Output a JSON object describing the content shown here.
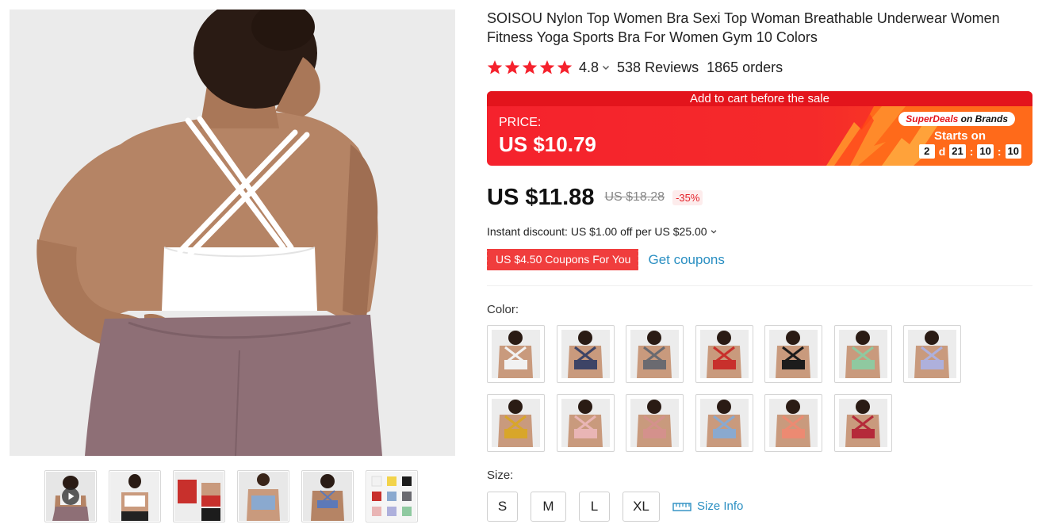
{
  "product": {
    "title": "SOISOU Nylon Top Women Bra Sexi Top Woman Breathable Underwear Women Fitness Yoga Sports Bra For Women Gym 10 Colors",
    "rating": "4.8",
    "reviews": "538 Reviews",
    "orders": "1865 orders"
  },
  "sale_banner": {
    "top_text": "Add to cart before the sale",
    "price_label": "PRICE:",
    "price_value": "US $10.79",
    "brand_super": "SuperDeals",
    "brand_rest": " on Brands",
    "starts_on": "Starts on",
    "countdown": {
      "days": "2",
      "d_label": "d",
      "hours": "21",
      "minutes": "10",
      "seconds": "10"
    }
  },
  "price": {
    "current": "US $11.88",
    "original": "US $18.28",
    "discount": "-35%"
  },
  "instant_discount": "Instant discount: US $1.00 off per US $25.00",
  "coupon": {
    "badge": "US $4.50 Coupons For You",
    "link": "Get coupons"
  },
  "color_label": "Color:",
  "colors": [
    {
      "name": "white",
      "hex": "#f2f2f2"
    },
    {
      "name": "navy",
      "hex": "#3d4466"
    },
    {
      "name": "grey",
      "hex": "#6a6a70"
    },
    {
      "name": "red",
      "hex": "#c8302c"
    },
    {
      "name": "black",
      "hex": "#1c1c1c"
    },
    {
      "name": "mint",
      "hex": "#8fc9a0"
    },
    {
      "name": "lavender",
      "hex": "#aeb0dc"
    },
    {
      "name": "mustard",
      "hex": "#d8a62a"
    },
    {
      "name": "pink",
      "hex": "#e9b5b5"
    },
    {
      "name": "dusty-rose",
      "hex": "#d4918c"
    },
    {
      "name": "light-blue",
      "hex": "#8aa9cf"
    },
    {
      "name": "coral",
      "hex": "#ec8a72"
    },
    {
      "name": "crimson",
      "hex": "#b52a3a"
    }
  ],
  "size_label": "Size:",
  "sizes": [
    "S",
    "M",
    "L",
    "XL"
  ],
  "size_info": "Size Info",
  "thumbnails": [
    {
      "icon": "play-icon",
      "color": "#f2f2f2"
    },
    {
      "color": "#f2f2f2"
    },
    {
      "color": "#c8302c"
    },
    {
      "color": "#8aa9cf"
    },
    {
      "color": "#5d79b8"
    },
    {
      "color": "#d9d9d9"
    }
  ],
  "theme": {
    "accent_red": "#f5222d",
    "link_blue": "#2a8fc2",
    "star": "#f5222d"
  }
}
